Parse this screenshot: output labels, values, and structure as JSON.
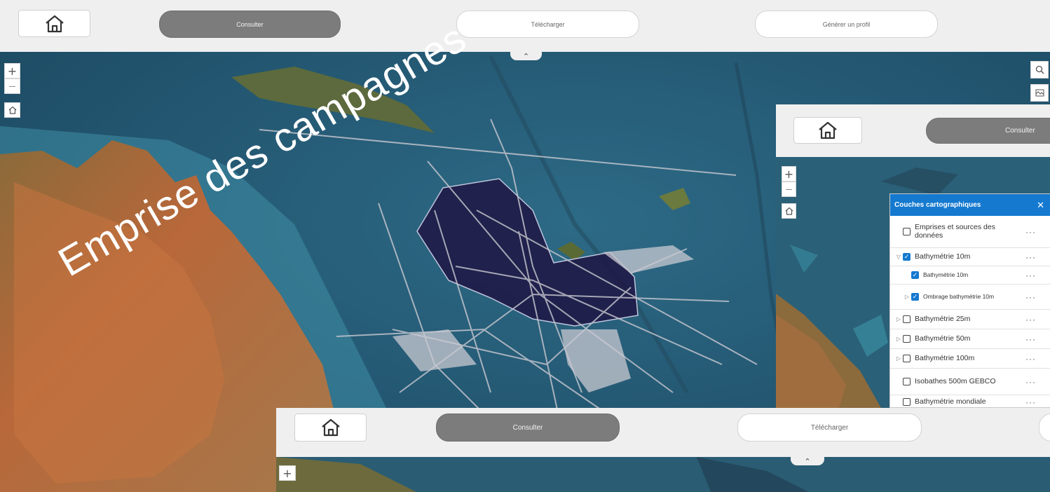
{
  "annotation": "Emprise des campagnes",
  "colors": {
    "accent": "#1479cf",
    "active_tab": "#7c7c7c",
    "toolbar": "#efefef",
    "ocean": "#2b5a72",
    "land": "#b0673a",
    "footprint": "#1f1a47"
  },
  "main": {
    "nav": {
      "home_icon": "home-icon",
      "consult": "Consulter",
      "download": "Télécharger",
      "profile": "Générer un profil"
    },
    "collapse_icon": "chevron-up-icon",
    "zoom_in": "+",
    "zoom_out": "—",
    "map_home_icon": "home-icon",
    "search_icon": "search-icon",
    "basemap_icon": "basemap-gallery-icon"
  },
  "inset_right": {
    "nav": {
      "home_icon": "home-icon",
      "consult": "Consulter"
    },
    "zoom_in": "+",
    "zoom_out": "—",
    "map_home_icon": "home-icon",
    "layers_panel": {
      "title": "Couches cartographiques",
      "close_icon": "close-icon",
      "layers": [
        {
          "label": "Emprises et sources des données",
          "checked": false,
          "caret": "",
          "indent": 0
        },
        {
          "label": "Bathymétrie 10m",
          "checked": true,
          "caret": "▽",
          "indent": 0
        },
        {
          "label": "Bathymétrie 10m",
          "checked": true,
          "caret": "",
          "indent": 1
        },
        {
          "label": "Ombrage bathymétrie 10m",
          "checked": true,
          "caret": "▷",
          "indent": 1
        },
        {
          "label": "Bathymétrie 25m",
          "checked": false,
          "caret": "▷",
          "indent": 0
        },
        {
          "label": "Bathymétrie 50m",
          "checked": false,
          "caret": "▷",
          "indent": 0
        },
        {
          "label": "Bathymétrie 100m",
          "checked": false,
          "caret": "▷",
          "indent": 0
        },
        {
          "label": "Isobathes 500m GEBCO",
          "checked": false,
          "caret": "",
          "indent": 0
        },
        {
          "label": "Bathymétrie mondiale",
          "checked": false,
          "caret": "",
          "indent": 0
        }
      ],
      "more_label": "···"
    }
  },
  "inset_bottom": {
    "nav": {
      "home_icon": "home-icon",
      "consult": "Consulter",
      "download": "Télécharger"
    },
    "collapse_icon": "chevron-up-icon",
    "zoom_in": "+"
  }
}
